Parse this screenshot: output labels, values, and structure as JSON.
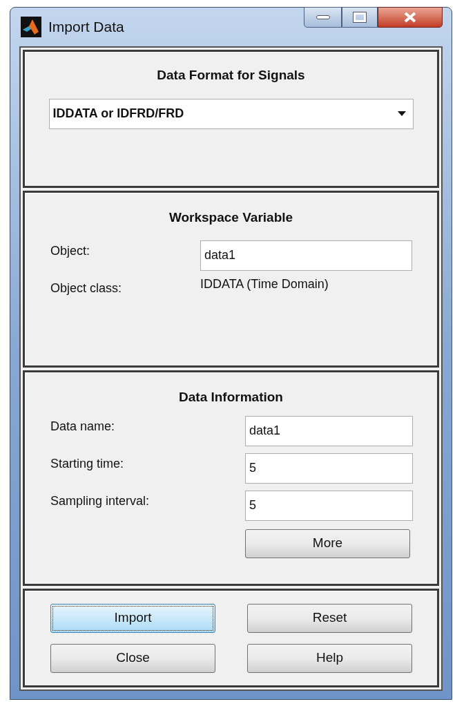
{
  "window": {
    "title": "Import Data"
  },
  "format_panel": {
    "heading": "Data Format for Signals",
    "dropdown": {
      "value": "IDDATA or IDFRD/FRD"
    }
  },
  "workspace_panel": {
    "heading": "Workspace Variable",
    "object": {
      "label": "Object:",
      "value": "data1"
    },
    "object_class": {
      "label": "Object class:",
      "value": "IDDATA (Time Domain)"
    }
  },
  "info_panel": {
    "heading": "Data Information",
    "fields": [
      {
        "label": "Data name:",
        "value": "data1"
      },
      {
        "label": "Starting time:",
        "value": "5"
      },
      {
        "label": "Sampling interval:",
        "value": "5"
      }
    ],
    "more_button": {
      "label": "More"
    }
  },
  "buttons": [
    {
      "label": "Import",
      "focused": true
    },
    {
      "label": "Reset",
      "focused": false
    },
    {
      "label": "Close",
      "focused": false
    },
    {
      "label": "Help",
      "focused": false
    }
  ]
}
